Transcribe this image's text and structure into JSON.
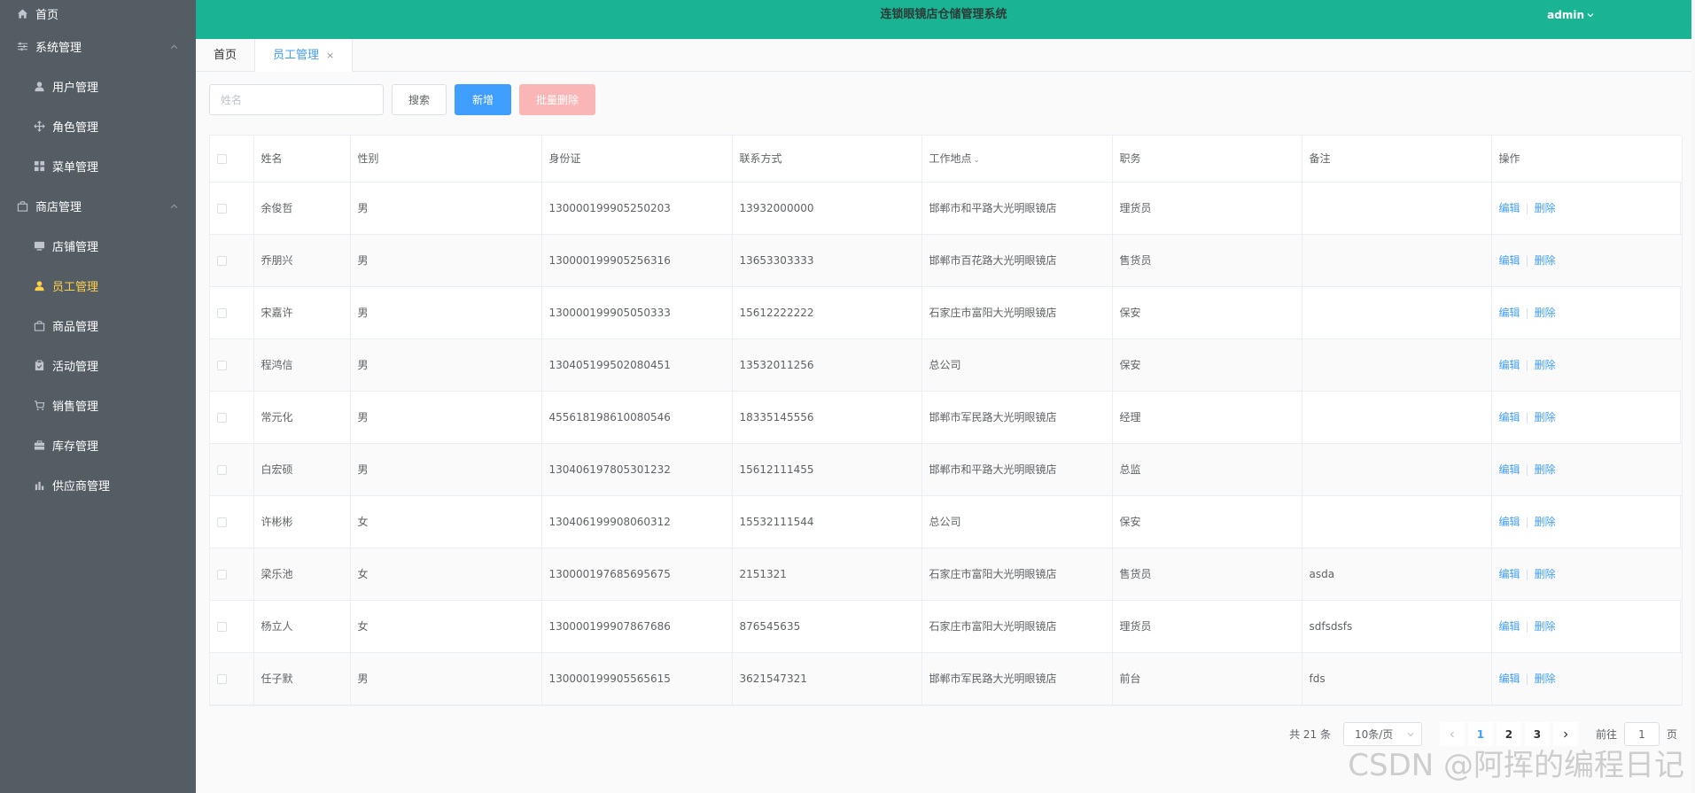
{
  "header": {
    "title": "连锁眼镜店仓储管理系统",
    "user": "admin"
  },
  "sidebar": {
    "items": [
      {
        "label": "首页",
        "icon": "home-icon",
        "level": "top"
      },
      {
        "label": "系统管理",
        "icon": "sliders-icon",
        "level": "group",
        "expanded": true
      },
      {
        "label": "用户管理",
        "icon": "user-icon",
        "level": "sub"
      },
      {
        "label": "角色管理",
        "icon": "crosshair-icon",
        "level": "sub"
      },
      {
        "label": "菜单管理",
        "icon": "grid-icon",
        "level": "sub"
      },
      {
        "label": "商店管理",
        "icon": "bag-icon",
        "level": "group",
        "expanded": true
      },
      {
        "label": "店铺管理",
        "icon": "monitor-icon",
        "level": "sub"
      },
      {
        "label": "员工管理",
        "icon": "user-icon",
        "level": "sub",
        "active": true
      },
      {
        "label": "商品管理",
        "icon": "bag-icon",
        "level": "sub"
      },
      {
        "label": "活动管理",
        "icon": "clipboard-icon",
        "level": "sub"
      },
      {
        "label": "销售管理",
        "icon": "cart-icon",
        "level": "sub"
      },
      {
        "label": "库存管理",
        "icon": "suitcase-icon",
        "level": "sub"
      },
      {
        "label": "供应商管理",
        "icon": "chart-icon",
        "level": "sub"
      }
    ]
  },
  "tabs": [
    {
      "label": "首页",
      "active": false
    },
    {
      "label": "员工管理",
      "active": true,
      "close": "×"
    }
  ],
  "toolbar": {
    "name_placeholder": "姓名",
    "search_label": "搜索",
    "add_label": "新增",
    "batch_delete_label": "批量删除"
  },
  "table": {
    "headers": [
      "姓名",
      "性别",
      "身份证",
      "联系方式",
      "工作地点",
      "职务",
      "备注",
      "操作"
    ],
    "sortable_header": "工作地点",
    "edit_label": "编辑",
    "delete_label": "删除",
    "rows": [
      {
        "name": "余俊哲",
        "gender": "男",
        "id_card": "130000199905250203",
        "phone": "13932000000",
        "location": "邯郸市和平路大光明眼镜店",
        "position": "理货员",
        "note": ""
      },
      {
        "name": "乔朋兴",
        "gender": "男",
        "id_card": "130000199905256316",
        "phone": "13653303333",
        "location": "邯郸市百花路大光明眼镜店",
        "position": "售货员",
        "note": ""
      },
      {
        "name": "宋嘉许",
        "gender": "男",
        "id_card": "130000199905050333",
        "phone": "15612222222",
        "location": "石家庄市富阳大光明眼镜店",
        "position": "保安",
        "note": ""
      },
      {
        "name": "程鸿信",
        "gender": "男",
        "id_card": "130405199502080451",
        "phone": "13532011256",
        "location": "总公司",
        "position": "保安",
        "note": ""
      },
      {
        "name": "常元化",
        "gender": "男",
        "id_card": "455618198610080546",
        "phone": "18335145556",
        "location": "邯郸市军民路大光明眼镜店",
        "position": "经理",
        "note": ""
      },
      {
        "name": "白宏硕",
        "gender": "男",
        "id_card": "130406197805301232",
        "phone": "15612111455",
        "location": "邯郸市和平路大光明眼镜店",
        "position": "总监",
        "note": ""
      },
      {
        "name": "许彬彬",
        "gender": "女",
        "id_card": "130406199908060312",
        "phone": "15532111544",
        "location": "总公司",
        "position": "保安",
        "note": ""
      },
      {
        "name": "梁乐池",
        "gender": "女",
        "id_card": "130000197685695675",
        "phone": "2151321",
        "location": "石家庄市富阳大光明眼镜店",
        "position": "售货员",
        "note": "asda"
      },
      {
        "name": "杨立人",
        "gender": "女",
        "id_card": "130000199907867686",
        "phone": "876545635",
        "location": "石家庄市富阳大光明眼镜店",
        "position": "理货员",
        "note": "sdfsdsfs"
      },
      {
        "name": "任子默",
        "gender": "男",
        "id_card": "130000199905565615",
        "phone": "3621547321",
        "location": "邯郸市军民路大光明眼镜店",
        "position": "前台",
        "note": "fds"
      }
    ]
  },
  "pagination": {
    "total_text": "共 21 条",
    "page_size": "10条/页",
    "pages": [
      "1",
      "2",
      "3"
    ],
    "current": "1",
    "goto_prefix": "前往",
    "goto_value": "1",
    "goto_suffix": "页"
  },
  "watermark": "CSDN @阿挥的编程日记",
  "colors": {
    "header_bg": "#1ab394",
    "sidebar_bg": "#545c64",
    "active_menu": "#ffd04b",
    "primary": "#409eff",
    "danger_disabled": "#fab6b6"
  }
}
